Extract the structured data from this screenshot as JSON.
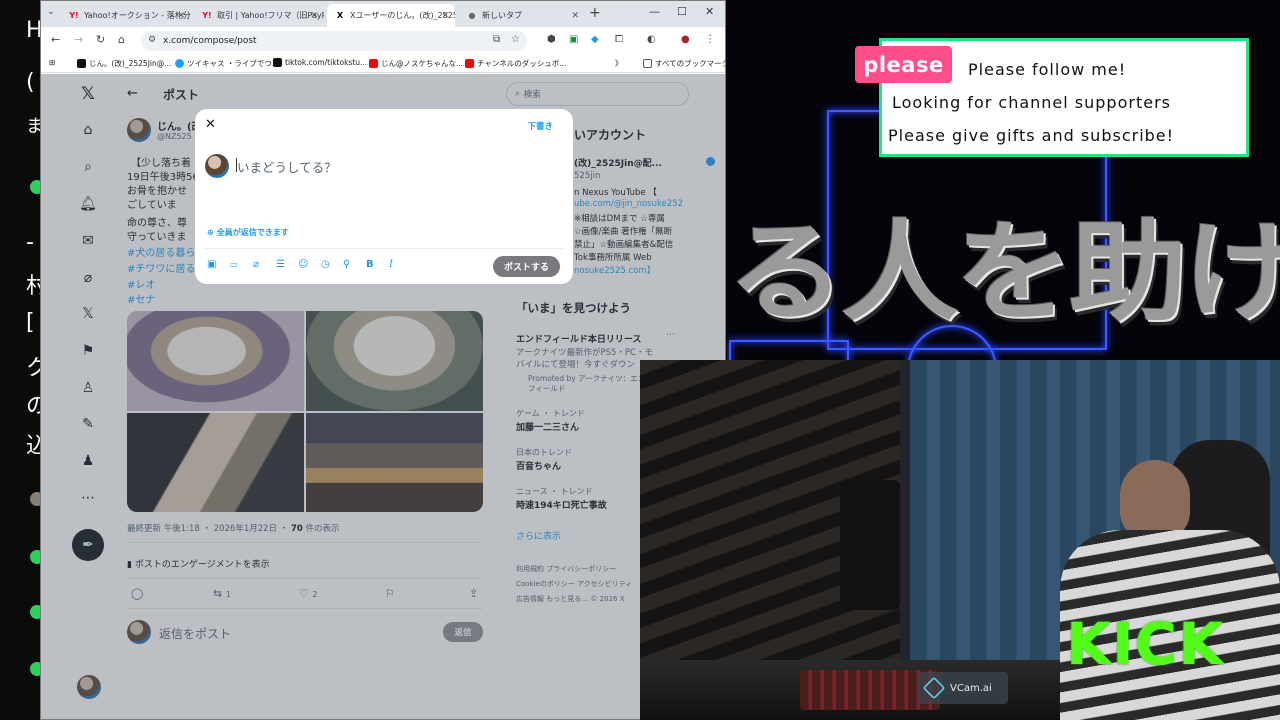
{
  "left_edge": {
    "chars": [
      "H",
      "(",
      "ま",
      "",
      "-",
      "村",
      "[",
      "ク",
      "の",
      "込"
    ]
  },
  "browser": {
    "tabs": [
      {
        "icon": "Y!",
        "label": "Yahoo!オークション - 落札分"
      },
      {
        "icon": "Y!",
        "label": "取引 | Yahoo!フリマ（旧PayPay）"
      },
      {
        "icon": "X",
        "label": "Xユーザーのじん。(改)_2525Jin"
      },
      {
        "icon": "●",
        "label": "新しいタブ"
      }
    ],
    "active_tab": 2,
    "url": "x.com/compose/post",
    "bookmarks": [
      {
        "label": "じん。(改)_2525Jin@...",
        "color": "#111111"
      },
      {
        "label": "ツイキャス ・ライブでつ...",
        "color": "#1da1f2"
      },
      {
        "label": "tiktok.com/tiktokstu...",
        "color": "#111111"
      },
      {
        "label": "じん@ノスケちゃんな...",
        "color": "#ff0000"
      },
      {
        "label": "チャンネルのダッシュボ...",
        "color": "#ff0000"
      }
    ],
    "bookmarks_more": "》",
    "all_bookmarks": "すべてのブックマーク"
  },
  "x_page": {
    "header_title": "ポスト",
    "author_name": "じん。(改",
    "author_handle": "@NZ525",
    "tweet_lines": [
      "【少し落ち着",
      "19日午後3時56",
      "お骨を抱かせ",
      "ごしていま",
      "命の尊さ、尊",
      "守っていきま"
    ],
    "hashtags": [
      "#犬の居る暮ら",
      "#チワワに居る",
      "#レオ",
      "#セナ"
    ],
    "meta": "最終更新 午後1:18 ・ 2026年1月22日 ・ ",
    "views_count": "70",
    "views_label": " 件の表示",
    "engagement": "ポストのエンゲージメントを表示",
    "retweets": "1",
    "likes": "2",
    "reply_placeholder": "返信をポスト",
    "reply_button": "返信",
    "search_placeholder": "検索",
    "recommend_title": "いアカウント",
    "profile_name": "(改)_2525Jin@配...",
    "profile_handle": "525jin",
    "profile_bio": [
      "n Nexus YouTube 【",
      "ube.com/@jin_nosuke252",
      "※相談はDMまで ☆専属",
      "☆画像/楽曲 著作権「無断",
      "禁止」☆動画編集者&配信",
      "Tok事務所所属 Web",
      "nosuke2525.com】"
    ],
    "trends_title": "「いま」を見つけよう",
    "trends": [
      {
        "cat": "",
        "title": "エンドフィールド本日リリース",
        "desc": "アークナイツ最新作がPS5・PC・モバイルにて登場！今すぐダウン",
        "promo": "Promoted by アークナイツ：エンドフィールド"
      },
      {
        "cat": "ゲーム ・ トレンド",
        "title": "加藤一二三さん"
      },
      {
        "cat": "日本のトレンド",
        "title": "百音ちゃん"
      },
      {
        "cat": "ニュース ・ トレンド",
        "title": "時速194キロ死亡事故"
      }
    ],
    "show_more": "さらに表示",
    "footer_lines": [
      "利用規約  プライバシーポリシー",
      "Cookieのポリシー  アクセシビリティ",
      "広告情報  もっと見る…  © 2026 X"
    ]
  },
  "compose": {
    "drafts": "下書き",
    "placeholder": "いまどうしてる？",
    "reply_setting": "全員が返信できます",
    "post_button": "ポストする",
    "tools": [
      "image-icon",
      "gif-icon",
      "grok-icon",
      "poll-icon",
      "emoji-icon",
      "schedule-icon",
      "location-icon",
      "bold-icon",
      "italic-icon"
    ]
  },
  "overlay": {
    "please": "please",
    "lines": [
      "Please follow me!",
      "Looking for channel supporters",
      "Please give gifts and subscribe!"
    ],
    "big_text": "る人を助ける",
    "kick": "KICK",
    "vcam": "VCam.ai",
    "colors": {
      "accent_green": "#23e089",
      "please_pink": "#ff4f8a",
      "kick_green": "#53fc18",
      "neon_blue": "#3c5cff"
    }
  }
}
